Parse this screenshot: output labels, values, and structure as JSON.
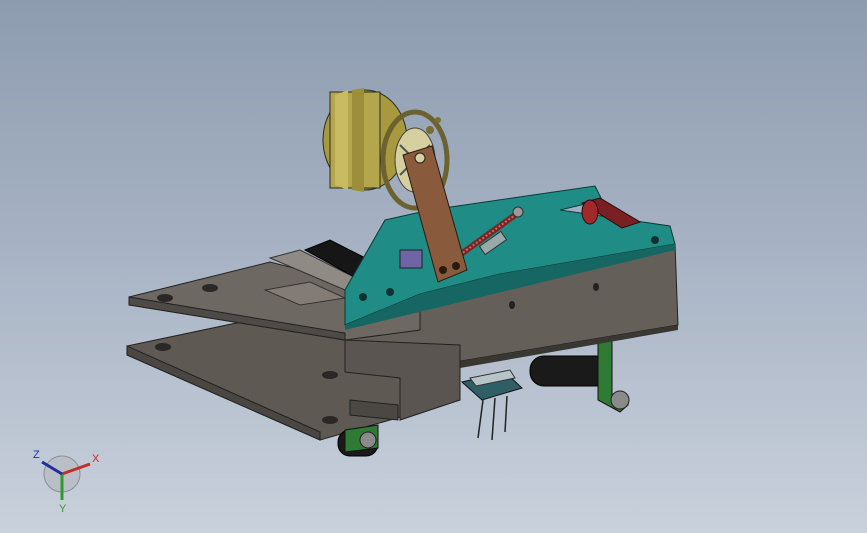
{
  "triad": {
    "x_label": "X",
    "y_label": "Y",
    "z_label": "Z",
    "x_color": "#c0302a",
    "y_color": "#2f9a2f",
    "z_color": "#1f2f9a"
  },
  "colors": {
    "background_top": "#8e9cb0",
    "background_bottom": "#c9d1dc",
    "base_plate": "#6e6862",
    "frame": "#1f8c86",
    "motor": "#b4a64c",
    "link_arm": "#8a5a3c",
    "roller": "#7a1f22",
    "wheel": "#1a1a1a",
    "bracket": "#2f7a34"
  },
  "icons": {
    "view_triad": "xyz-axis-triad-icon"
  }
}
